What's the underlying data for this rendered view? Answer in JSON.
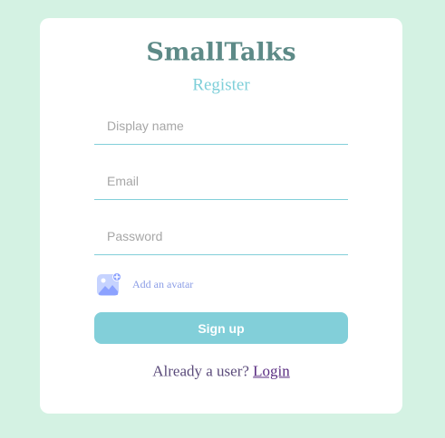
{
  "app": {
    "logo": "SmallTalks",
    "subtitle": "Register"
  },
  "form": {
    "display_name": {
      "placeholder": "Display name",
      "value": ""
    },
    "email": {
      "placeholder": "Email",
      "value": ""
    },
    "password": {
      "placeholder": "Password",
      "value": ""
    },
    "avatar": {
      "label": "Add an avatar",
      "icon": "add-image-icon"
    },
    "submit_label": "Sign up"
  },
  "footer": {
    "prompt": "Already a user?",
    "link_label": "Login"
  },
  "colors": {
    "background": "#d4f2e3",
    "card": "#ffffff",
    "logo": "#5d8a87",
    "accent": "#82cfd9",
    "avatar_link": "#8c9ee6"
  }
}
